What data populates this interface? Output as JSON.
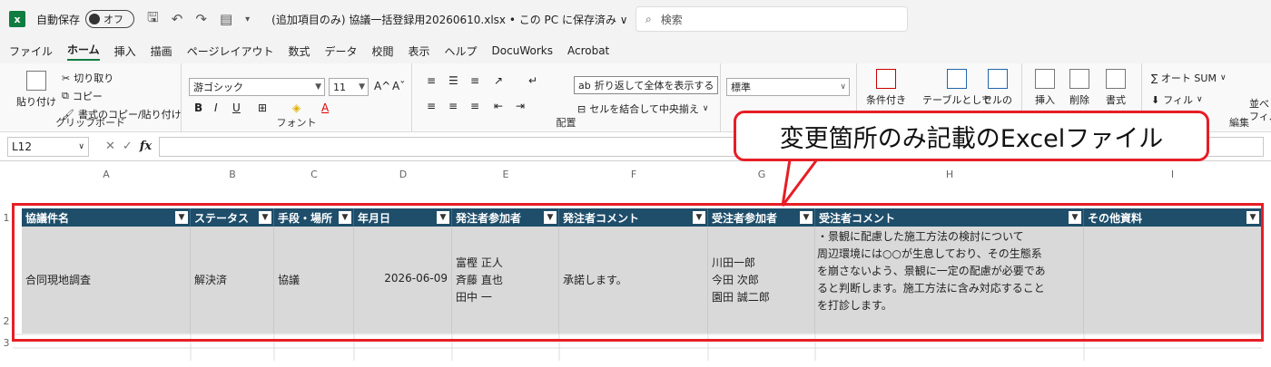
{
  "titlebar": {
    "autosave_label": "自動保存",
    "autosave_state": "オフ",
    "filename": "(追加項目のみ) 協議一括登録用20260610.xlsx • この PC に保存済み ∨",
    "search_placeholder": "検索"
  },
  "menu": {
    "items": [
      "ファイル",
      "ホーム",
      "挿入",
      "描画",
      "ページレイアウト",
      "数式",
      "データ",
      "校閲",
      "表示",
      "ヘルプ",
      "DocuWorks",
      "Acrobat"
    ],
    "active": "ホーム"
  },
  "ribbon": {
    "clipboard": {
      "paste": "貼り付け",
      "cut": "切り取り",
      "copy": "コピー",
      "format_painter": "書式のコピー/貼り付け",
      "label": "クリップボード"
    },
    "font": {
      "font_name": "游ゴシック",
      "font_size": "11",
      "label": "フォント",
      "grow": "A^",
      "shrink": "Aˇ",
      "bold": "B",
      "italic": "I",
      "underline": "U"
    },
    "alignment": {
      "wrap_text": "折り返して全体を表示する",
      "merge_center": "セルを結合して中央揃え",
      "label": "配置"
    },
    "number": {
      "format": "標準"
    },
    "styles": {
      "cond_format": "条件付き",
      "table_format": "テーブルとして",
      "cell_styles": "セルの"
    },
    "cells": {
      "insert": "挿入",
      "delete": "削除",
      "format": "書式"
    },
    "editing": {
      "autosum": "∑ オート SUM",
      "fill": "フィル",
      "sort_filter": "並べ",
      "filter": "フィル",
      "label": "編集"
    }
  },
  "formula_bar": {
    "name_box": "L12",
    "fx": "fx"
  },
  "sheet": {
    "columns": [
      "A",
      "B",
      "C",
      "D",
      "E",
      "F",
      "G",
      "H",
      "I"
    ],
    "rows": [
      "1",
      "2",
      "3"
    ],
    "header": [
      "協議件名",
      "ステータス",
      "手段・場所",
      "年月日",
      "発注者参加者",
      "発注者コメント",
      "受注者参加者",
      "受注者コメント",
      "その他資料"
    ],
    "row2": {
      "title": "合同現地調査",
      "status": "解決済",
      "method": "協議",
      "date": "2026-06-09",
      "client_participants": [
        "富樫 正人",
        "斉藤 直也",
        "田中 一"
      ],
      "client_comment": "承諾します。",
      "contractor_participants": [
        "川田一郎",
        "今田 次郎",
        "園田 誠二郎"
      ],
      "contractor_comment": [
        "・景観に配慮した施工方法の検討について",
        "周辺環境には○○が生息しており、その生態系",
        "を崩さないよう、景観に一定の配慮が必要であ",
        "ると判断します。施工方法に含み対応すること",
        "を打診します。"
      ],
      "other": ""
    }
  },
  "callout": {
    "text": "変更箇所のみ記載のExcelファイル"
  },
  "colors": {
    "header_bg": "#1f4e6b",
    "row_bg": "#d9d9d9",
    "highlight": "#e61e25",
    "excel_green": "#107c41"
  }
}
